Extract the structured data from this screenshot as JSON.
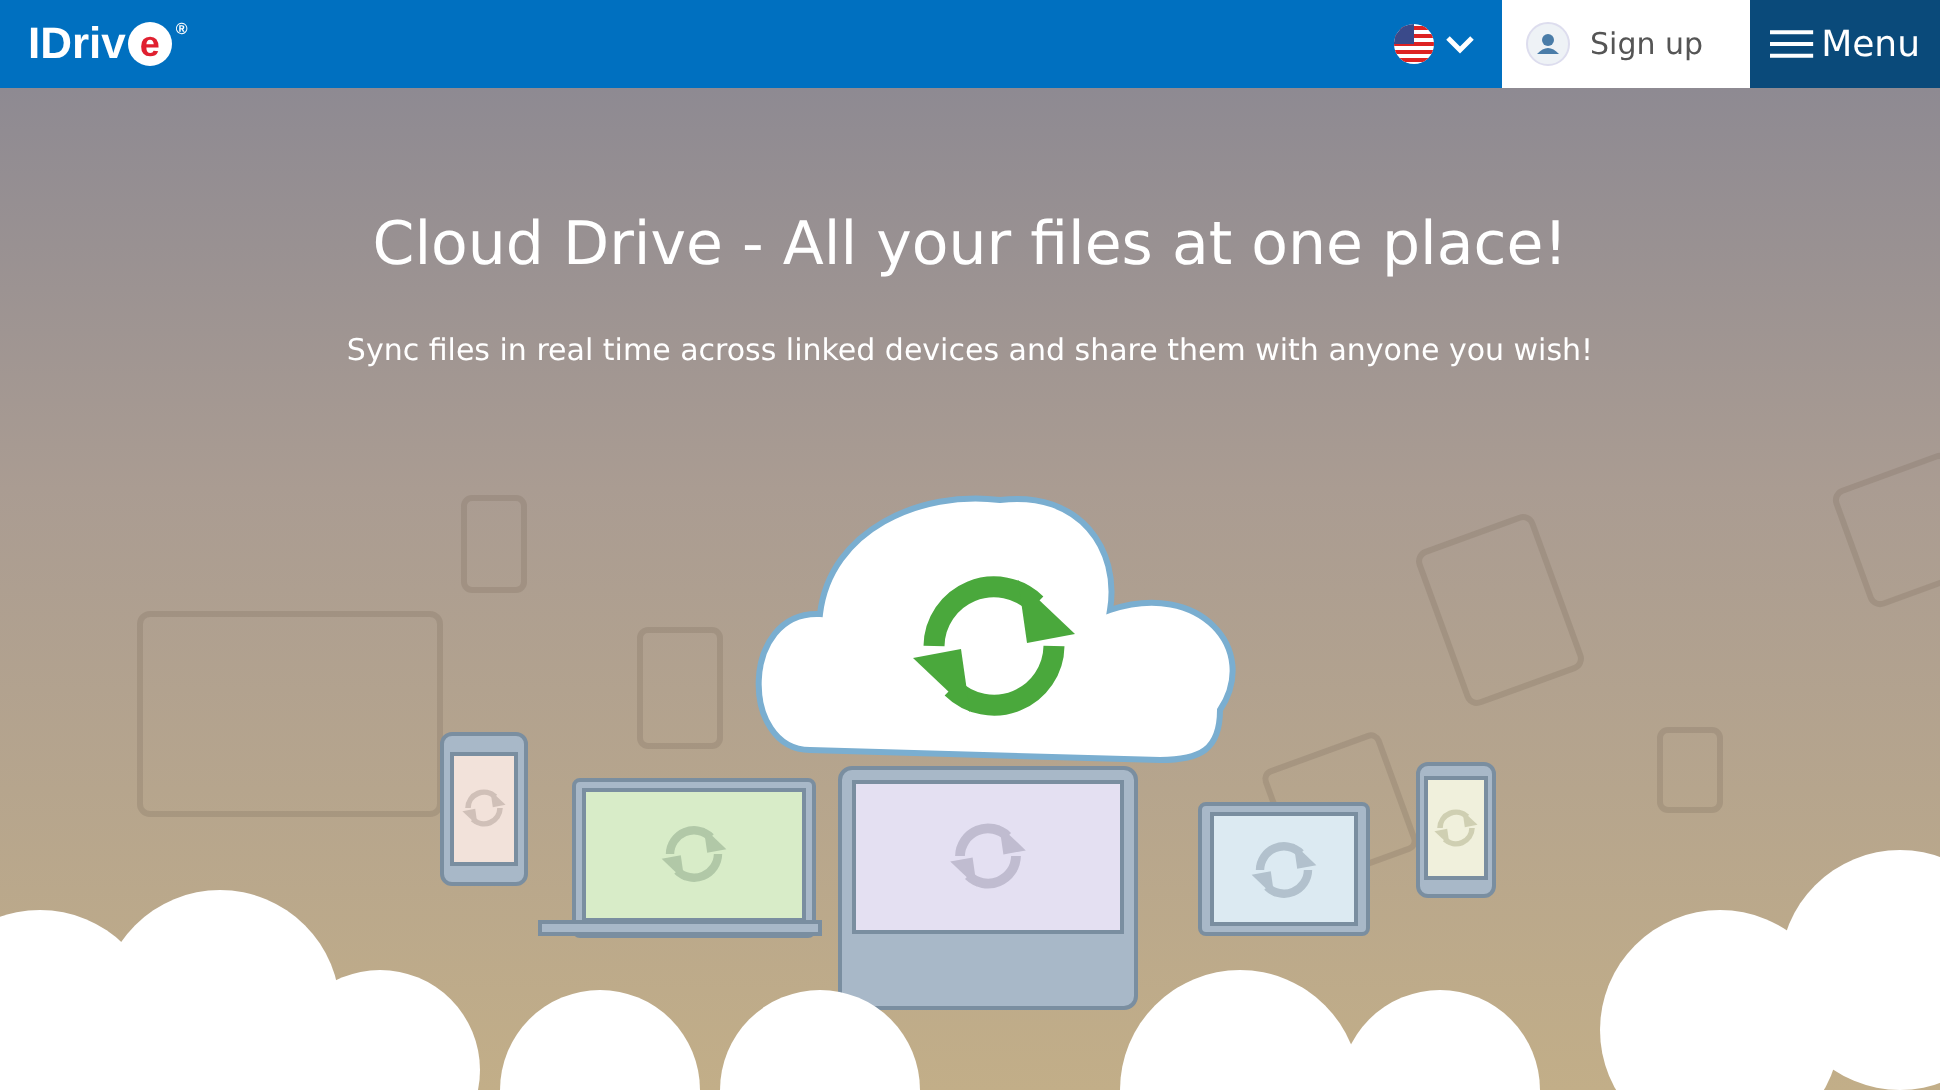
{
  "header": {
    "logo": {
      "text": "IDriv",
      "accent": "e",
      "registered": "®"
    },
    "sign_up": "Sign up",
    "menu": "Menu"
  },
  "hero": {
    "title": "Cloud Drive - All your files at one place!",
    "subtitle": "Sync files in real time across linked devices and share them with anyone you wish!"
  }
}
